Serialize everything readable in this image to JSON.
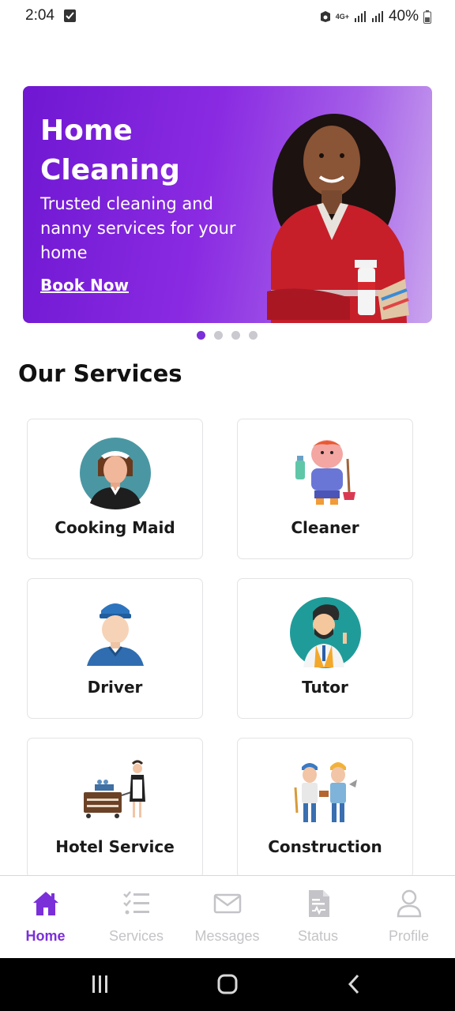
{
  "status_bar": {
    "time": "2:04",
    "network": "4G+",
    "battery": "40%"
  },
  "banner": {
    "title": "Home Cleaning",
    "subtitle": "Trusted cleaning and nanny services for your home",
    "cta": "Book Now",
    "slides": 4,
    "active_slide": 1
  },
  "services_section": {
    "title": "Our Services",
    "items": [
      {
        "label": "Cooking Maid",
        "icon": "maid-avatar-icon"
      },
      {
        "label": "Cleaner",
        "icon": "cleaner-icon"
      },
      {
        "label": "Driver",
        "icon": "driver-icon"
      },
      {
        "label": "Tutor",
        "icon": "tutor-icon"
      },
      {
        "label": "Hotel Service",
        "icon": "hotel-service-icon"
      },
      {
        "label": "Construction",
        "icon": "construction-icon"
      }
    ]
  },
  "bottom_nav": {
    "items": [
      {
        "label": "Home",
        "icon": "home-icon",
        "active": true
      },
      {
        "label": "Services",
        "icon": "checklist-icon",
        "active": false
      },
      {
        "label": "Messages",
        "icon": "mail-icon",
        "active": false
      },
      {
        "label": "Status",
        "icon": "document-icon",
        "active": false
      },
      {
        "label": "Profile",
        "icon": "user-icon",
        "active": false
      }
    ]
  },
  "colors": {
    "accent": "#7b2fd9",
    "inactive": "#c4c4c8",
    "banner_start": "#6f17d2",
    "banner_end": "#caa6ee"
  }
}
